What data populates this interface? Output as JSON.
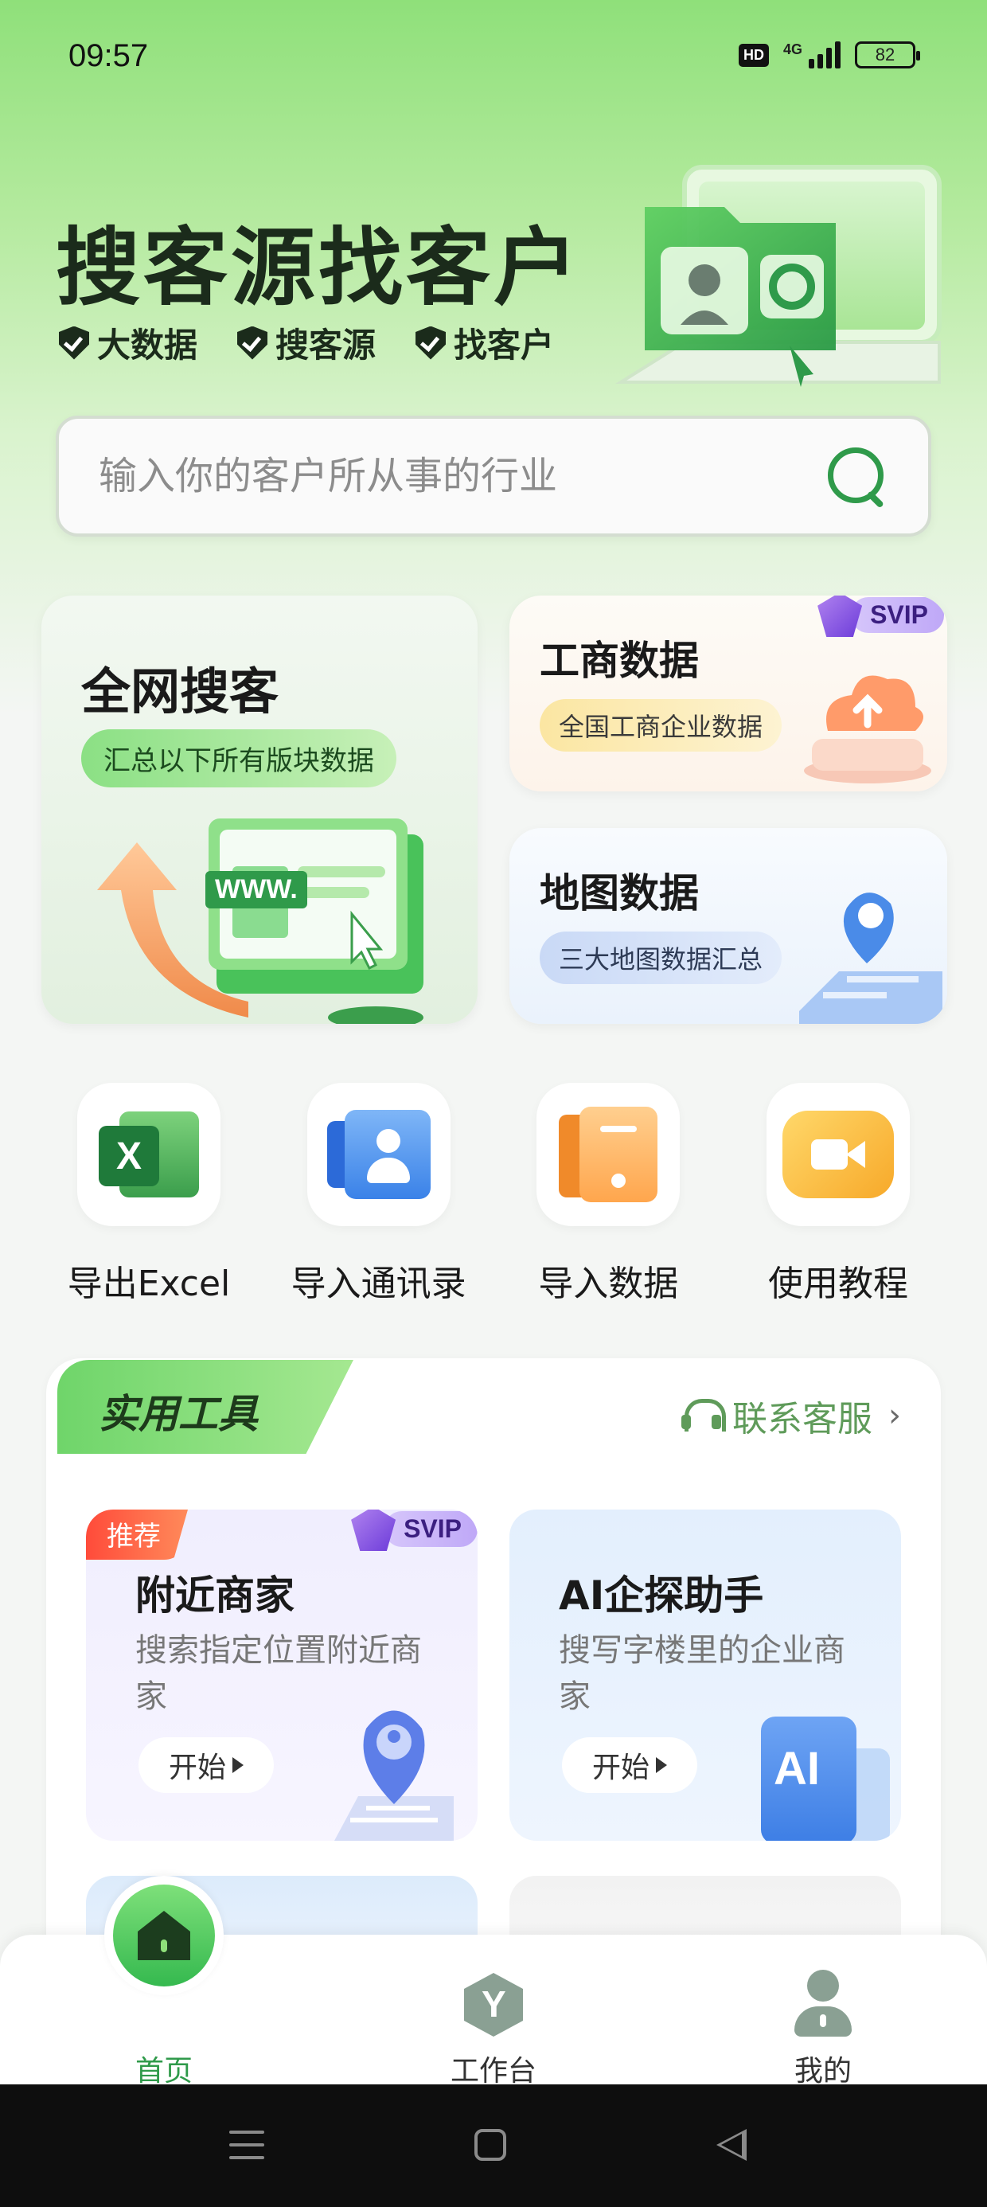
{
  "status_bar": {
    "time": "09:57",
    "hd_badge": "HD",
    "network": "4G",
    "battery": "82"
  },
  "hero": {
    "title": "搜客源找客户",
    "tags": [
      "大数据",
      "搜客源",
      "找客户"
    ]
  },
  "search": {
    "placeholder": "输入你的客户所从事的行业"
  },
  "categories": {
    "all_web": {
      "title": "全网搜客",
      "subtitle": "汇总以下所有版块数据",
      "illustration_text": "WWW."
    },
    "business": {
      "title": "工商数据",
      "subtitle": "全国工商企业数据",
      "badge": "SVIP"
    },
    "map": {
      "title": "地图数据",
      "subtitle": "三大地图数据汇总"
    }
  },
  "quick_actions": [
    {
      "label": "导出Excel",
      "icon": "excel-icon",
      "glyph": "X"
    },
    {
      "label": "导入通讯录",
      "icon": "contacts-icon"
    },
    {
      "label": "导入数据",
      "icon": "import-data-icon"
    },
    {
      "label": "使用教程",
      "icon": "video-tutorial-icon"
    }
  ],
  "tools": {
    "title": "实用工具",
    "support_label": "联系客服",
    "items": [
      {
        "title": "附近商家",
        "desc": "搜索指定位置附近商家",
        "start_label": "开始",
        "badge": "推荐",
        "svip": "SVIP",
        "icon": "map-pin-icon"
      },
      {
        "title": "AI企探助手",
        "desc": "搜写字楼里的企业商家",
        "start_label": "开始",
        "icon": "ai-icon",
        "icon_text": "AI"
      }
    ]
  },
  "bottom_nav": {
    "items": [
      {
        "label": "首页",
        "icon": "home-icon",
        "active": true
      },
      {
        "label": "工作台",
        "icon": "workbench-icon",
        "active": false
      },
      {
        "label": "我的",
        "icon": "user-icon",
        "active": false
      }
    ]
  },
  "colors": {
    "brand_green": "#35b94f",
    "accent_green": "#2f9a4a",
    "svip_purple": "#6c3bd9",
    "recommend_red": "#ff4b3a"
  }
}
